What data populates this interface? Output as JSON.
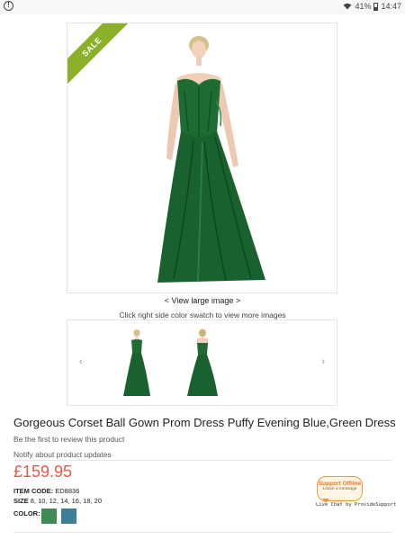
{
  "status_bar": {
    "left_icon": "info-circle-icon",
    "battery": "41%",
    "time": "14:47"
  },
  "product": {
    "sale_label": "SALE",
    "view_large_label": "< View large image >",
    "swatch_hint": "Click right side color swatch to view more images",
    "title": "Gorgeous Corset Ball Gown Prom Dress Puffy Evening Blue,Green Dress",
    "review_text": "Be the first to review this product",
    "notify_text": "Notify about product updates",
    "price": "£159.95",
    "item_code_label": "ITEM CODE:",
    "item_code": "ED8836",
    "size_label": "SIZE",
    "sizes": "8, 10, 12, 14, 16, 18, 20",
    "color_label": "COLOR:",
    "colors": [
      "#3f8a57",
      "#3f7e97"
    ],
    "dress_color": "#1f6b34",
    "sale_color": "#8bb12a",
    "price_color": "#e25a4a"
  },
  "gallery": {
    "prev_label": "‹",
    "next_label": "›"
  },
  "support": {
    "badge_line1": "Support Offline",
    "badge_line2": "Leave a message",
    "livechat": "Live Chat by ProvideSupport"
  }
}
